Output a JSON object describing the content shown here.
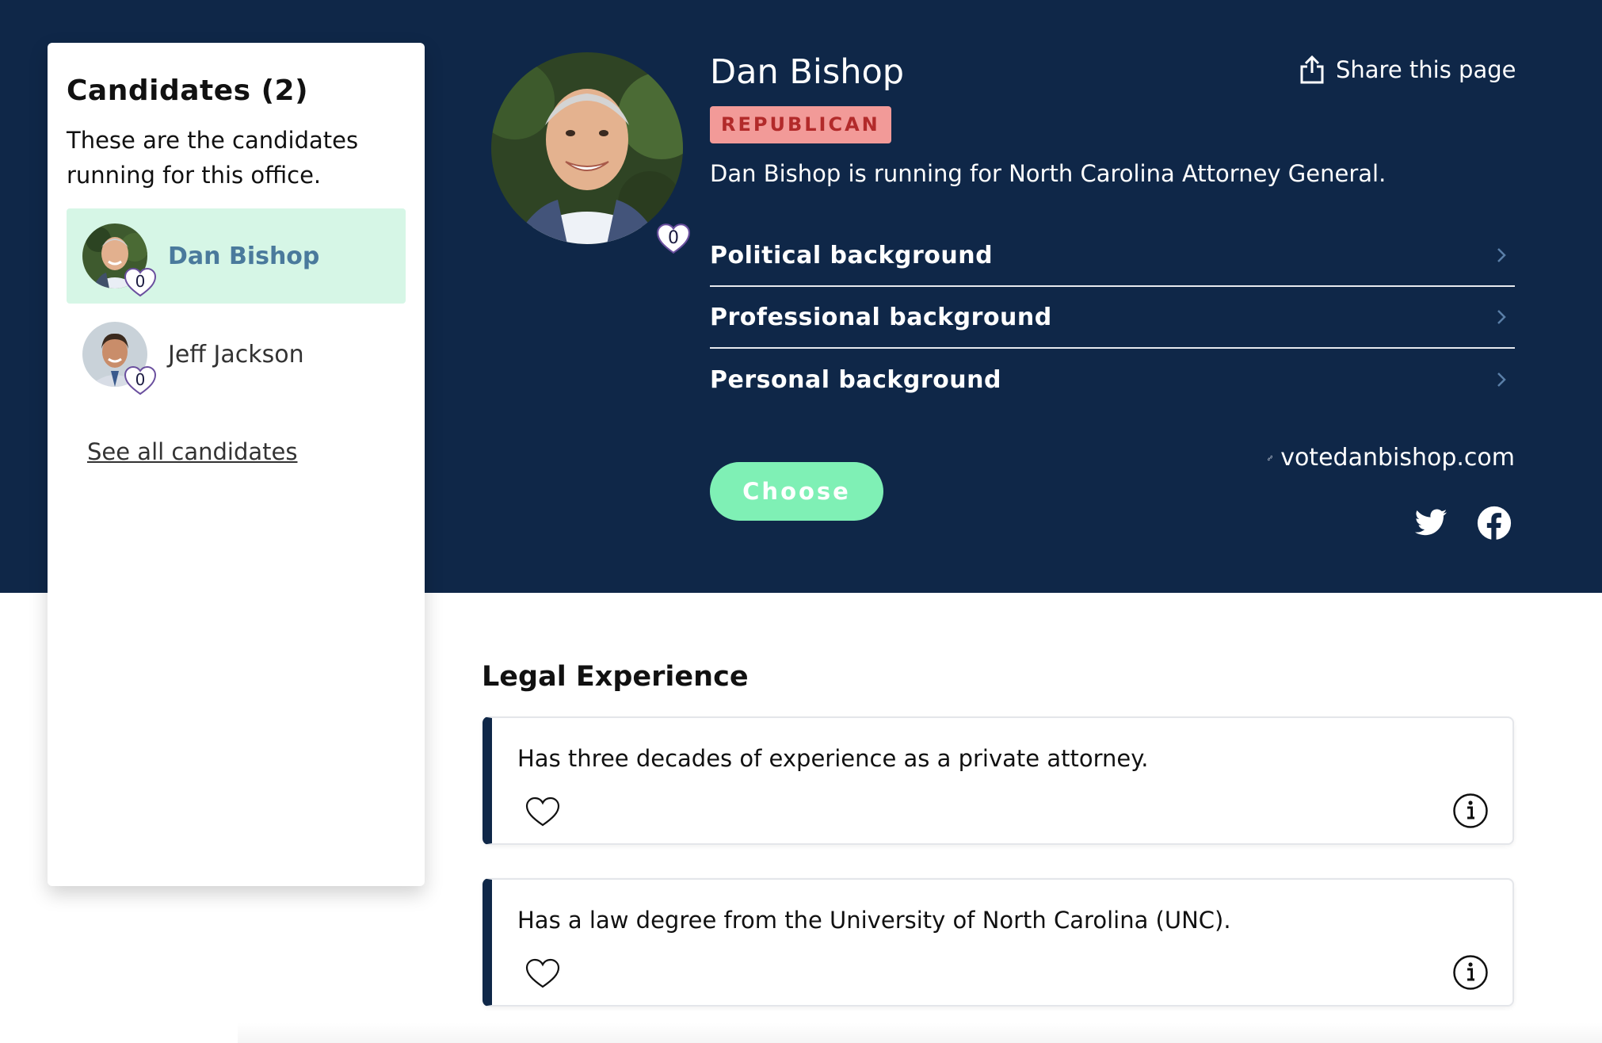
{
  "sidebar": {
    "title": "Candidates (2)",
    "description": "These are the candidates running for this office.",
    "candidates": [
      {
        "name": "Dan Bishop",
        "likes": "0",
        "active": true
      },
      {
        "name": "Jeff Jackson",
        "likes": "0",
        "active": false
      }
    ],
    "see_all": "See all candidates"
  },
  "profile": {
    "name": "Dan Bishop",
    "party": "REPUBLICAN",
    "summary": "Dan Bishop is running for North Carolina Attorney General.",
    "likes": "0",
    "share_label": "Share this page",
    "accordion": [
      {
        "label": "Political background"
      },
      {
        "label": "Professional background"
      },
      {
        "label": "Personal background"
      }
    ],
    "website": "votedanbishop.com",
    "choose_label": "Choose",
    "social": [
      "twitter-icon",
      "facebook-icon"
    ]
  },
  "legal": {
    "title": "Legal Experience",
    "items": [
      {
        "text": "Has three decades of experience as a private attorney."
      },
      {
        "text": "Has a law degree from the University of North Carolina (UNC)."
      }
    ]
  },
  "colors": {
    "hero_bg": "#0f2748",
    "party_bg": "#f29a98",
    "party_text": "#b22a2a",
    "choose_bg": "#7ff0b5",
    "active_candidate_bg": "#d6f6e6"
  }
}
